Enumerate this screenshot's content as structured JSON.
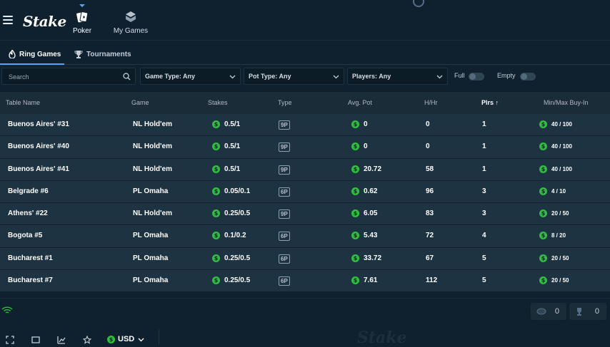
{
  "header": {
    "logo": "Stake",
    "nav": [
      {
        "label": "Poker",
        "icon": "poker-cards-icon",
        "active": true
      },
      {
        "label": "My Games",
        "icon": "my-games-icon",
        "active": false
      }
    ]
  },
  "tabs": [
    {
      "label": "Ring Games",
      "icon": "flame-icon",
      "active": true
    },
    {
      "label": "Tournaments",
      "icon": "trophy-icon",
      "active": false
    }
  ],
  "filters": {
    "search_placeholder": "Search",
    "game_type": "Game Type: Any",
    "pot_type": "Pot Type: Any",
    "players": "Players: Any",
    "full_label": "Full",
    "empty_label": "Empty"
  },
  "table": {
    "headers": [
      "Table Name",
      "Game",
      "Stakes",
      "Type",
      "Avg. Pot",
      "H/Hr",
      "Plrs ↑",
      "Min/Max Buy-In"
    ],
    "rows": [
      {
        "name": "Buenos Aires' #31",
        "game": "NL Hold'em",
        "stakes": "0.5/1",
        "type": "9P",
        "avg_pot": "0",
        "hhr": "0",
        "plrs": "1",
        "buyin": "40 / 100"
      },
      {
        "name": "Buenos Aires' #40",
        "game": "NL Hold'em",
        "stakes": "0.5/1",
        "type": "9P",
        "avg_pot": "0",
        "hhr": "0",
        "plrs": "1",
        "buyin": "40 / 100"
      },
      {
        "name": "Buenos Aires' #41",
        "game": "NL Hold'em",
        "stakes": "0.5/1",
        "type": "9P",
        "avg_pot": "20.72",
        "hhr": "58",
        "plrs": "1",
        "buyin": "40 / 100"
      },
      {
        "name": "Belgrade #6",
        "game": "PL Omaha",
        "stakes": "0.05/0.1",
        "type": "6P",
        "avg_pot": "0.62",
        "hhr": "96",
        "plrs": "3",
        "buyin": "4 / 10"
      },
      {
        "name": "Athens' #22",
        "game": "NL Hold'em",
        "stakes": "0.25/0.5",
        "type": "9P",
        "avg_pot": "6.05",
        "hhr": "83",
        "plrs": "3",
        "buyin": "20 / 50"
      },
      {
        "name": "Bogota #5",
        "game": "PL Omaha",
        "stakes": "0.1/0.2",
        "type": "6P",
        "avg_pot": "5.43",
        "hhr": "72",
        "plrs": "4",
        "buyin": "8 / 20"
      },
      {
        "name": "Bucharest #1",
        "game": "PL Omaha",
        "stakes": "0.25/0.5",
        "type": "6P",
        "avg_pot": "33.72",
        "hhr": "67",
        "plrs": "5",
        "buyin": "20 / 50"
      },
      {
        "name": "Bucharest #7",
        "game": "PL Omaha",
        "stakes": "0.25/0.5",
        "type": "6P",
        "avg_pot": "7.61",
        "hhr": "112",
        "plrs": "5",
        "buyin": "20 / 50"
      }
    ]
  },
  "footer": {
    "chips_count": "0",
    "trophy_count": "0",
    "currency": "USD",
    "watermark": "Stake"
  },
  "colors": {
    "background": "#0f212e",
    "row": "#1e3341",
    "header_row": "#1a2c38",
    "accent_blue": "#4aa8ff",
    "coin_green": "#2fbf3f"
  }
}
